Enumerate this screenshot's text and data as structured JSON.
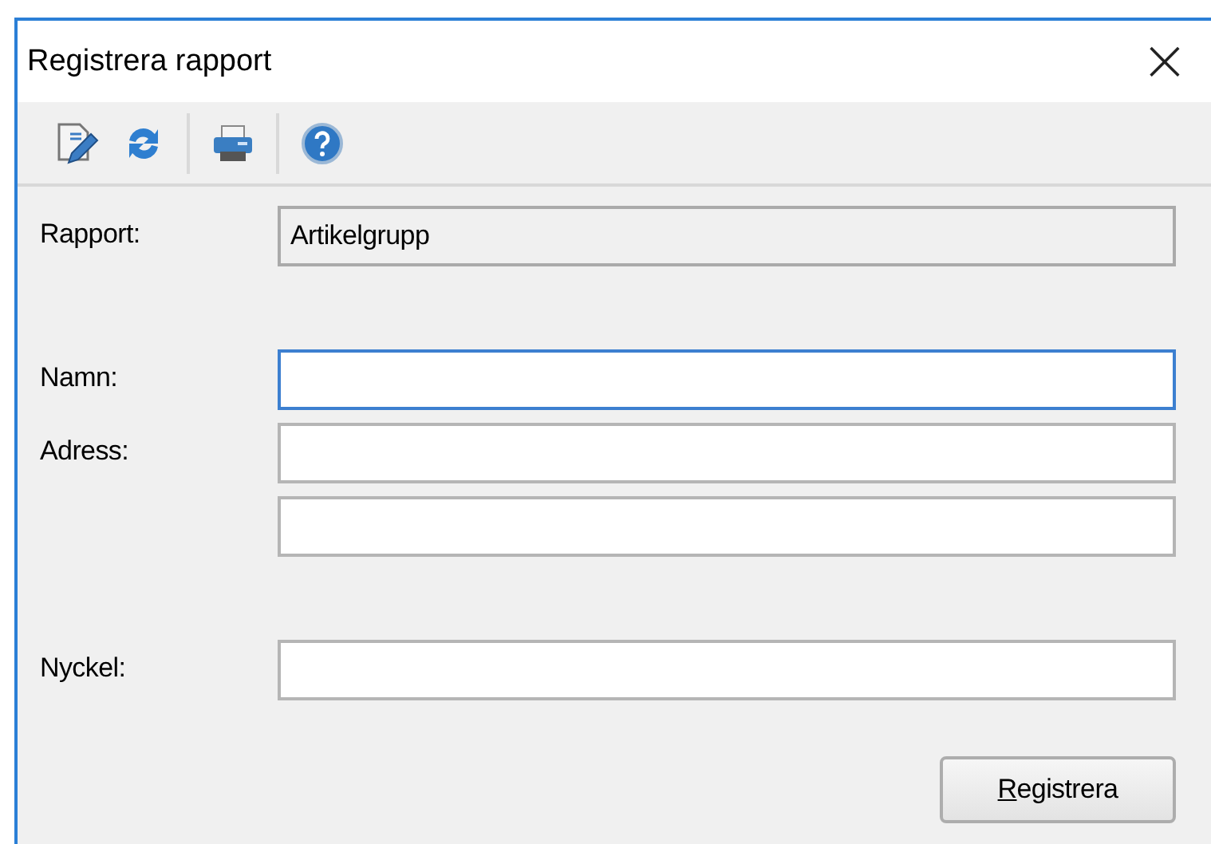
{
  "window": {
    "title": "Registrera rapport",
    "close": "×"
  },
  "toolbar": {
    "groups": [
      {
        "items": [
          {
            "kind": "edit"
          },
          {
            "kind": "refresh"
          }
        ]
      },
      {
        "items": [
          {
            "kind": "print"
          }
        ]
      },
      {
        "items": [
          {
            "kind": "help"
          }
        ]
      }
    ]
  },
  "sections": [
    {
      "rows": [
        {
          "label": "Rapport",
          "colon": ":",
          "kind": "readonly",
          "value": "Artikelgrupp"
        }
      ]
    },
    {
      "rows": [
        {
          "label": "Namn",
          "colon": ":",
          "kind": "input",
          "focused": true
        },
        {
          "label": "Adress",
          "colon": ":",
          "kind": "input",
          "focused": false
        },
        {
          "kind": "input",
          "focused": false
        }
      ]
    },
    {
      "rows": [
        {
          "label": "Nyckel",
          "colon": ":",
          "kind": "input",
          "focused": false
        }
      ]
    }
  ],
  "buttons": [
    {
      "label": "Registrera"
    }
  ]
}
